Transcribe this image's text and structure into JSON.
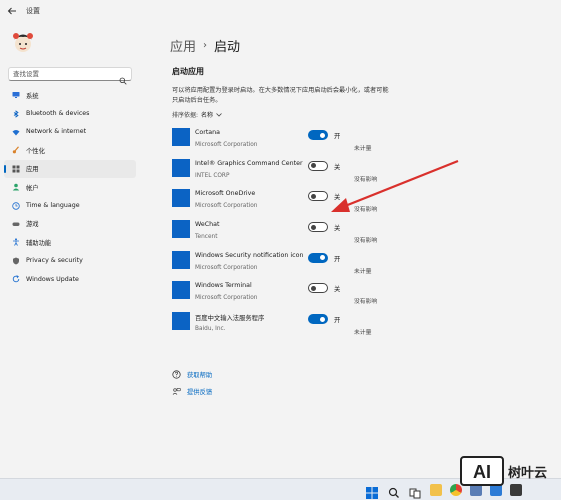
{
  "window": {
    "title": "设置",
    "back_icon": "back-arrow-icon"
  },
  "sidebar": {
    "search_placeholder": "查找设置",
    "items": [
      {
        "label": "系统",
        "icon": "monitor-icon",
        "color": "#2b6fd6"
      },
      {
        "label": "Bluetooth & devices",
        "icon": "bluetooth-icon",
        "color": "#0b63c4"
      },
      {
        "label": "Network & internet",
        "icon": "wifi-icon",
        "color": "#1f6fd0"
      },
      {
        "label": "个性化",
        "icon": "brush-icon",
        "color": "#d9822b"
      },
      {
        "label": "应用",
        "icon": "apps-icon",
        "color": "#555555",
        "active": true
      },
      {
        "label": "帐户",
        "icon": "person-icon",
        "color": "#2ba36a"
      },
      {
        "label": "Time & language",
        "icon": "globe-clock-icon",
        "color": "#1f6fd0"
      },
      {
        "label": "游戏",
        "icon": "gamepad-icon",
        "color": "#666666"
      },
      {
        "label": "辅助功能",
        "icon": "accessibility-icon",
        "color": "#1f6fd0"
      },
      {
        "label": "Privacy & security",
        "icon": "shield-icon",
        "color": "#666666"
      },
      {
        "label": "Windows Update",
        "icon": "update-icon",
        "color": "#1f6fd0"
      }
    ]
  },
  "breadcrumb": {
    "parent": "应用",
    "separator": "›",
    "current": "启动"
  },
  "section": {
    "title": "启动应用",
    "description": "可以将应用配置为登录时启动。在大多数情况下应用启动后会最小化，或者可能只启动后台任务。",
    "sort_label": "排序依据:",
    "sort_value": "名称"
  },
  "apps": [
    {
      "name": "Cortana",
      "publisher": "Microsoft Corporation",
      "state": "开",
      "on": true,
      "impact": "未计量"
    },
    {
      "name": "Intel® Graphics Command Center S...",
      "publisher": "INTEL CORP",
      "state": "关",
      "on": false,
      "impact": "没有影响"
    },
    {
      "name": "Microsoft OneDrive",
      "publisher": "Microsoft Corporation",
      "state": "关",
      "on": false,
      "impact": "没有影响"
    },
    {
      "name": "WeChat",
      "publisher": "Tencent",
      "state": "关",
      "on": false,
      "impact": "没有影响"
    },
    {
      "name": "Windows Security notification icon",
      "publisher": "Microsoft Corporation",
      "state": "开",
      "on": true,
      "impact": "未计量"
    },
    {
      "name": "Windows Terminal",
      "publisher": "Microsoft Corporation",
      "state": "关",
      "on": false,
      "impact": "没有影响"
    },
    {
      "name": "百度中文输入法服务程序",
      "publisher": "Baidu, Inc.",
      "state": "开",
      "on": true,
      "impact": "未计量"
    }
  ],
  "links": [
    {
      "label": "获取帮助",
      "icon": "help-icon"
    },
    {
      "label": "提供反馈",
      "icon": "feedback-icon"
    }
  ],
  "colors": {
    "accent": "#0067c0",
    "annotation_arrow": "#d9302c",
    "app_tile": "#0b63c4"
  },
  "watermark": {
    "logo_text": "AI",
    "text": "树叶云"
  }
}
